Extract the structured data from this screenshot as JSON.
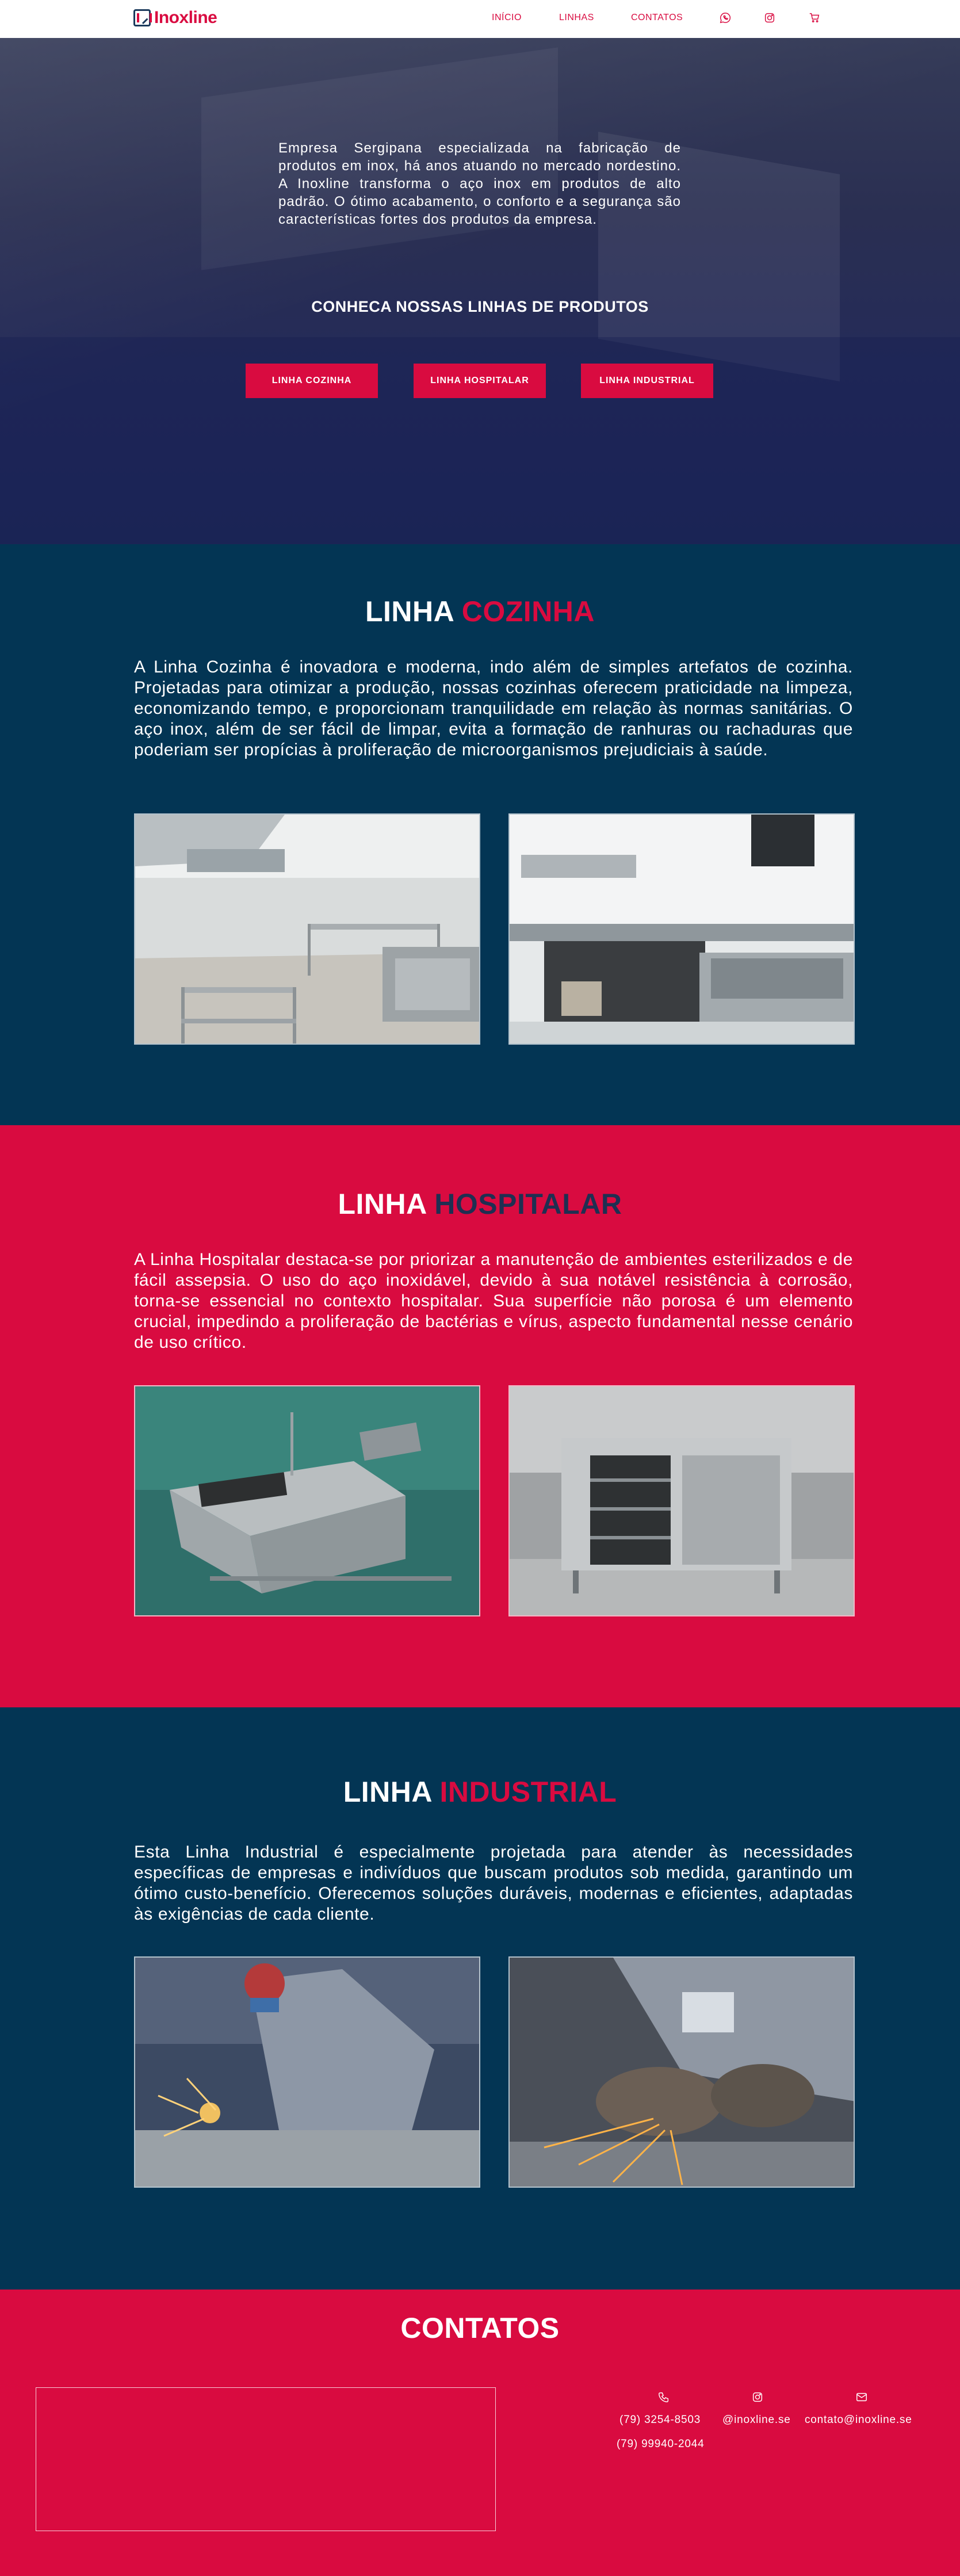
{
  "brand": {
    "name": "Inoxline"
  },
  "nav": {
    "links": [
      "INÍCIO",
      "LINHAS",
      "CONTATOS"
    ],
    "icons": [
      "whatsapp-icon",
      "instagram-icon",
      "cart-icon"
    ]
  },
  "hero": {
    "text": "Empresa Sergipana especializada na fabricação de produtos em inox, há anos atuando no mercado nordestino. A Inoxline transforma o aço inox em produtos de alto padrão. O ótimo acabamento, o conforto e a segurança são características fortes dos produtos da empresa.",
    "subtitle": "CONHECA NOSSAS LINHAS DE PRODUTOS",
    "buttons": [
      "LINHA COZINHA",
      "LINHA HOSPITALAR",
      "LINHA INDUSTRIAL"
    ]
  },
  "cozinha": {
    "title_a": "LINHA ",
    "title_b": "COZINHA",
    "text": "A Linha Cozinha é inovadora e moderna, indo além de simples artefatos de cozinha. Projetadas para otimizar a produção, nossas cozinhas oferecem praticidade na limpeza, economizando tempo, e proporcionam tranquilidade em relação às normas sanitárias. O aço inox, além de ser fácil de limpar, evita a formação de ranhuras ou rachaduras que poderiam ser propícias à proliferação de microorganismos prejudiciais à saúde."
  },
  "hospitalar": {
    "title_a": "LINHA ",
    "title_b": "HOSPITALAR",
    "text": "A Linha Hospitalar destaca-se por priorizar a manutenção de ambientes esterilizados e de fácil assepsia. O uso do aço inoxidável, devido à sua notável resistência à corrosão, torna-se essencial no contexto hospitalar. Sua superfície não porosa é um elemento crucial, impedindo a proliferação de bactérias e vírus, aspecto fundamental nesse cenário de uso crítico."
  },
  "industrial": {
    "title_a": "LINHA ",
    "title_b": "INDUSTRIAL",
    "text": "Esta Linha Industrial é especialmente projetada para atender às necessidades específicas de empresas e indivíduos que buscam produtos sob medida, garantindo um ótimo custo-benefício. Oferecemos soluções duráveis, modernas e eficientes, adaptadas às exigências de cada cliente."
  },
  "contacts": {
    "title": "CONTATOS",
    "phone_1": "(79) 3254-8503",
    "phone_2": "(79) 99940-2044",
    "instagram": "@inoxline.se",
    "email": "contato@inoxline.se"
  },
  "colors": {
    "red": "#d90b40",
    "navy": "#033554",
    "hero": "#232a5a"
  }
}
